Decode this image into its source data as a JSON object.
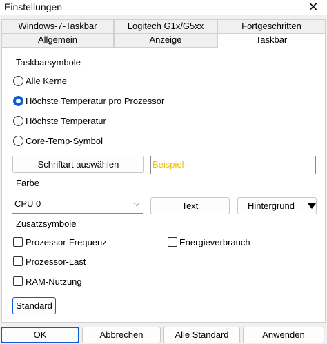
{
  "window": {
    "title": "Einstellungen"
  },
  "tabs_row1": [
    "Windows-7-Taskbar",
    "Logitech G1x/G5xx",
    "Fortgeschritten"
  ],
  "tabs_row2": [
    "Allgemein",
    "Anzeige",
    "Taskbar"
  ],
  "taskbar": {
    "section_icons": "Taskbarsymbole",
    "radios": [
      "Alle Kerne",
      "Höchste Temperatur pro Prozessor",
      "Höchste Temperatur",
      "Core-Temp-Symbol"
    ],
    "selected_radio": 1,
    "font_button": "Schriftart auswählen",
    "sample_text": "Beispiel",
    "sample_color": "#f0c000",
    "section_color": "Farbe",
    "cpu_select_value": "CPU 0",
    "text_button": "Text",
    "background_button": "Hintergrund",
    "section_extra": "Zusatzsymbole",
    "checkboxes": [
      "Prozessor-Frequenz",
      "Energieverbrauch",
      "Prozessor-Last",
      "RAM-Nutzung"
    ],
    "default_button": "Standard"
  },
  "footer": {
    "ok": "OK",
    "cancel": "Abbrechen",
    "all_default": "Alle Standard",
    "apply": "Anwenden"
  },
  "colors": {
    "accent": "#0b5cd6"
  }
}
